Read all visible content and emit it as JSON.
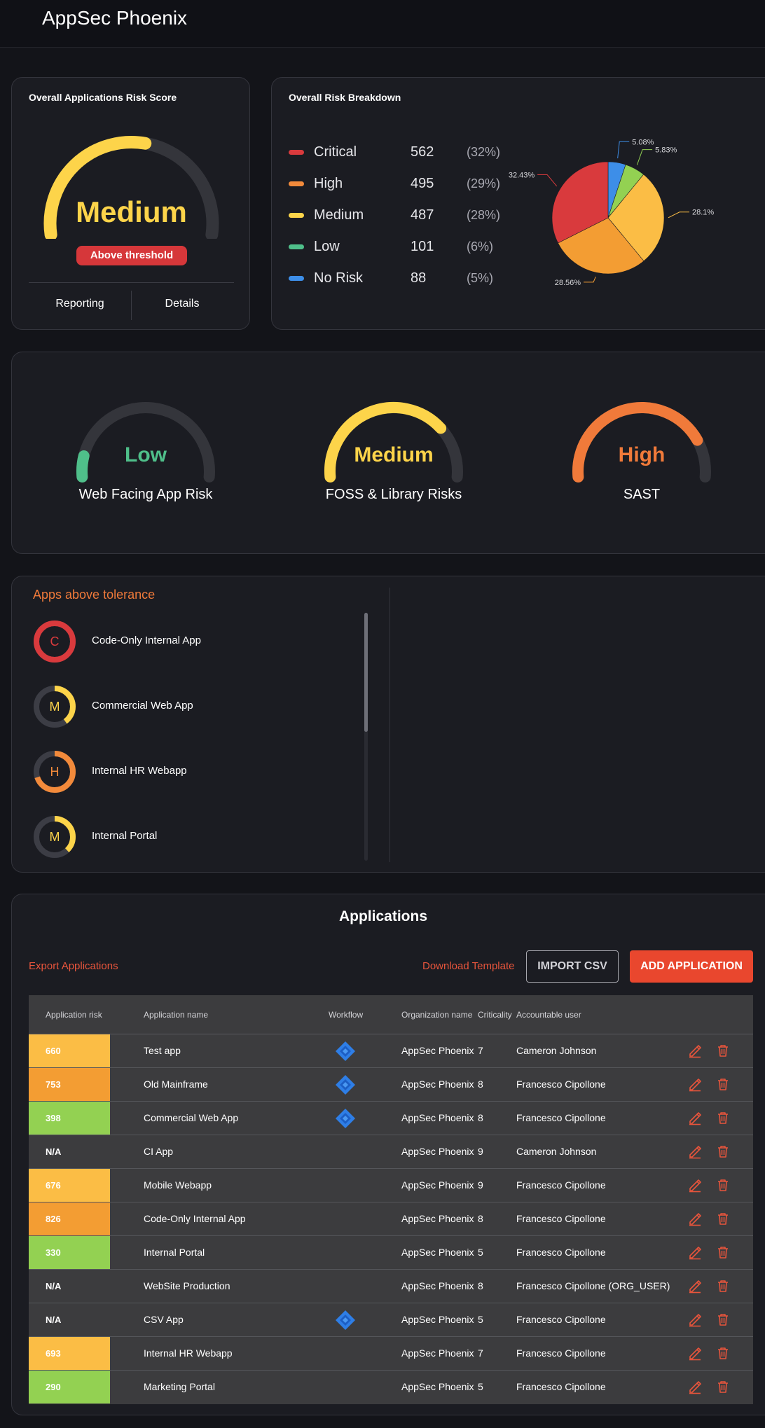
{
  "app": {
    "title": "AppSec Phoenix"
  },
  "colors": {
    "critical": "#d93a3d",
    "high": "#f28a3b",
    "medium": "#fdd44a",
    "low": "#4fbf8a",
    "no_risk": "#3d8ee8",
    "accent": "#e9472e",
    "risk_yellow": "#fbbd45",
    "risk_orange": "#f39d33",
    "risk_green": "#93d152"
  },
  "score_card": {
    "title": "Overall Applications Risk Score",
    "gauge_level": 0.55,
    "label": "Medium",
    "badge": "Above threshold",
    "links": [
      "Reporting",
      "Details"
    ]
  },
  "breakdown": {
    "title": "Overall Risk Breakdown",
    "rows": [
      {
        "name": "Critical",
        "count": "562",
        "pct": "(32%)",
        "color": "#d93a3d"
      },
      {
        "name": "High",
        "count": "495",
        "pct": "(29%)",
        "color": "#f28a3b"
      },
      {
        "name": "Medium",
        "count": "487",
        "pct": "(28%)",
        "color": "#fdd44a"
      },
      {
        "name": "Low",
        "count": "101",
        "pct": "(6%)",
        "color": "#4fbf8a"
      },
      {
        "name": "No Risk",
        "count": "88",
        "pct": "(5%)",
        "color": "#3d8ee8"
      }
    ]
  },
  "chart_data": {
    "type": "pie",
    "slices": [
      {
        "label": "5.08%",
        "value": 5.08,
        "color": "#3d8ee8"
      },
      {
        "label": "5.83%",
        "value": 5.83,
        "color": "#93d152"
      },
      {
        "label": "28.1%",
        "value": 28.1,
        "color": "#fbbd45"
      },
      {
        "label": "28.56%",
        "value": 28.56,
        "color": "#f39d33"
      },
      {
        "label": "32.43%",
        "value": 32.43,
        "color": "#d93a3d"
      }
    ]
  },
  "category_gauges": [
    {
      "label": "Low",
      "name": "Web Facing App Risk",
      "level": 0.1,
      "color": "#4fbf8a"
    },
    {
      "label": "Medium",
      "name": "FOSS & Library Risks",
      "level": 0.75,
      "color": "#fdd44a"
    },
    {
      "label": "High",
      "name": "SAST",
      "level": 0.82,
      "color": "#f07a3a"
    }
  ],
  "tolerance": {
    "title": "Apps above tolerance",
    "items": [
      {
        "letter": "C",
        "name": "Code-Only Internal App",
        "level": 1.0,
        "color": "#d93a3d"
      },
      {
        "letter": "M",
        "name": "Commercial Web App",
        "level": 0.4,
        "color": "#fdd44a"
      },
      {
        "letter": "H",
        "name": "Internal HR Webapp",
        "level": 0.7,
        "color": "#f28a3b"
      },
      {
        "letter": "M",
        "name": "Internal Portal",
        "level": 0.38,
        "color": "#fdd44a"
      }
    ]
  },
  "applications": {
    "title": "Applications",
    "export_label": "Export Applications",
    "download_label": "Download Template",
    "import_label": "IMPORT CSV",
    "add_label": "ADD APPLICATION",
    "columns": [
      "Application risk",
      "Application name",
      "Workflow",
      "Organization name",
      "Criticality",
      "Accountable user"
    ],
    "rows": [
      {
        "risk": "660",
        "risk_color": "#fbbd45",
        "name": "Test app",
        "workflow": true,
        "org": "AppSec Phoenix",
        "criticality": "7",
        "user": "Cameron Johnson"
      },
      {
        "risk": "753",
        "risk_color": "#f39d33",
        "name": "Old Mainframe",
        "workflow": true,
        "org": "AppSec Phoenix",
        "criticality": "8",
        "user": "Francesco Cipollone"
      },
      {
        "risk": "398",
        "risk_color": "#93d152",
        "name": "Commercial Web App",
        "workflow": true,
        "org": "AppSec Phoenix",
        "criticality": "8",
        "user": "Francesco Cipollone"
      },
      {
        "risk": "N/A",
        "risk_color": "",
        "name": "CI App",
        "workflow": false,
        "org": "AppSec Phoenix",
        "criticality": "9",
        "user": "Cameron Johnson"
      },
      {
        "risk": "676",
        "risk_color": "#fbbd45",
        "name": "Mobile Webapp",
        "workflow": false,
        "org": "AppSec Phoenix",
        "criticality": "9",
        "user": "Francesco Cipollone"
      },
      {
        "risk": "826",
        "risk_color": "#f39d33",
        "name": "Code-Only Internal App",
        "workflow": false,
        "org": "AppSec Phoenix",
        "criticality": "8",
        "user": "Francesco Cipollone"
      },
      {
        "risk": "330",
        "risk_color": "#93d152",
        "name": "Internal Portal",
        "workflow": false,
        "org": "AppSec Phoenix",
        "criticality": "5",
        "user": "Francesco Cipollone"
      },
      {
        "risk": "N/A",
        "risk_color": "",
        "name": "WebSite Production",
        "workflow": false,
        "org": "AppSec Phoenix",
        "criticality": "8",
        "user": "Francesco Cipollone (ORG_USER)"
      },
      {
        "risk": "N/A",
        "risk_color": "",
        "name": "CSV App",
        "workflow": true,
        "org": "AppSec Phoenix",
        "criticality": "5",
        "user": "Francesco Cipollone"
      },
      {
        "risk": "693",
        "risk_color": "#fbbd45",
        "name": "Internal HR Webapp",
        "workflow": false,
        "org": "AppSec Phoenix",
        "criticality": "7",
        "user": "Francesco Cipollone"
      },
      {
        "risk": "290",
        "risk_color": "#93d152",
        "name": "Marketing Portal",
        "workflow": false,
        "org": "AppSec Phoenix",
        "criticality": "5",
        "user": "Francesco Cipollone"
      }
    ]
  }
}
